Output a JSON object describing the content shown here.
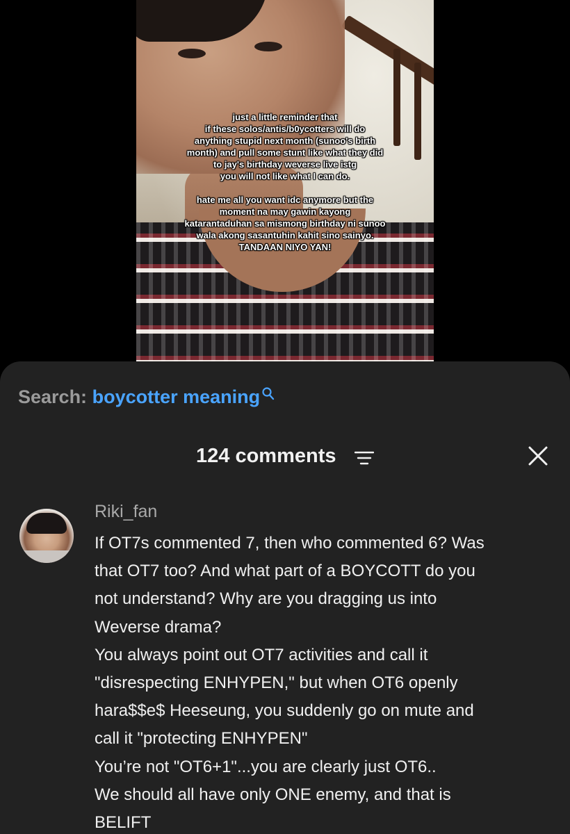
{
  "video": {
    "overlay_paragraph_1": [
      "just a little reminder that",
      "if these solos/antis/b0ycotters will do",
      "anything stupid next month (sunoo's birth",
      "month) and pull some stunt like what they did",
      "to jay's birthday weverse live istg",
      "you will not like what I can do."
    ],
    "overlay_paragraph_2": [
      "hate me all you want idc anymore but the",
      "moment na may gawin kayong",
      "katarantaduhan sa mismong birthday ni sunoo",
      "wala akong sasantuhin kahit sino sainyo.",
      "TANDAAN NIYO YAN!"
    ]
  },
  "search": {
    "prefix": "Search:",
    "query": "boycotter meaning",
    "icon": "search-icon"
  },
  "comments_header": {
    "count_label": "124 comments",
    "sort_icon": "sort-icon",
    "close_icon": "close-icon"
  },
  "comments": [
    {
      "username": "Riki_fan",
      "text_lines": [
        "If OT7s commented 7, then who commented 6? Was",
        "that OT7 too? And what part of a BOYCOTT do you",
        "not understand? Why are you dragging us into",
        "Weverse drama?",
        "You always point out OT7 activities and call it",
        "\"disrespecting ENHYPEN,\" but when OT6 openly",
        "hara$$e$ Heeseung, you suddenly go on mute and",
        "call it \"protecting ENHYPEN\"",
        "You’re not \"OT6+1\"...you are clearly just OT6..",
        "We should all have only ONE enemy, and that is",
        "BELIFT"
      ]
    }
  ],
  "colors": {
    "sheet_background": "#222222",
    "link_blue": "#4aa4ff",
    "muted_gray": "#9b9b9b",
    "text_white": "#f0f0f0"
  }
}
